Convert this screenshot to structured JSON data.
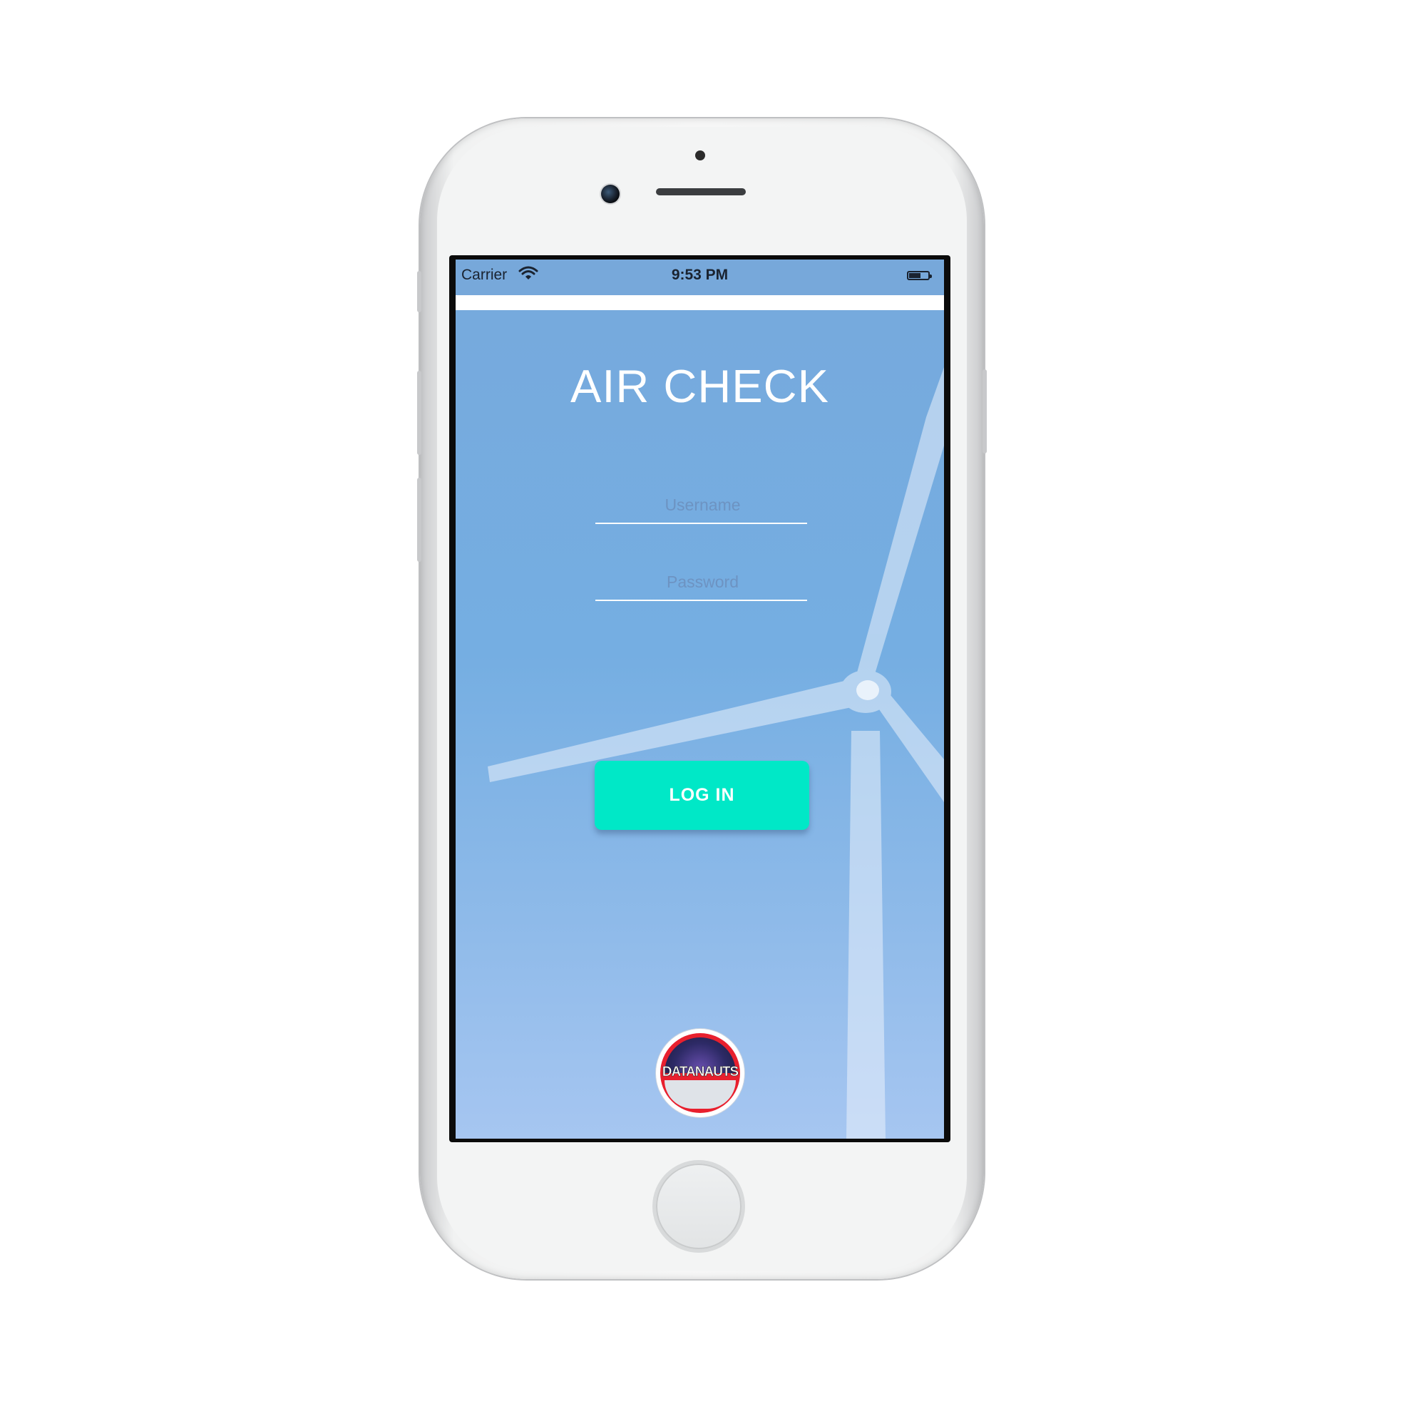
{
  "status_bar": {
    "carrier": "Carrier",
    "time": "9:53 PM",
    "wifi_icon": "wifi-icon",
    "battery_icon": "battery-icon"
  },
  "app": {
    "title": "AIR CHECK",
    "username": {
      "placeholder": "Username",
      "value": ""
    },
    "password": {
      "placeholder": "Password",
      "value": ""
    },
    "login_label": "LOG IN",
    "logo_text": "DATANAUTS",
    "background": "wind-turbine-image"
  },
  "colors": {
    "screen_background": "#76a9dc",
    "status_bar": "#77a8da",
    "login_button": "#00e8c7",
    "title_text": "#ffffff",
    "logo_ring": "#e8202e"
  }
}
